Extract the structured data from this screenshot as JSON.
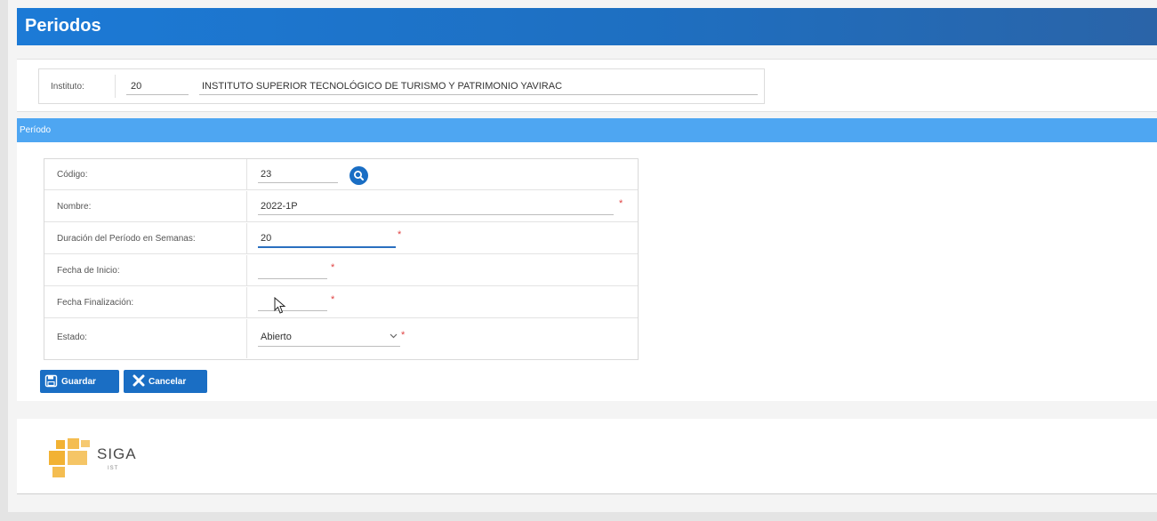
{
  "header": {
    "title": "Periodos"
  },
  "instituto": {
    "label": "Instituto:",
    "code": "20",
    "name": "INSTITUTO SUPERIOR TECNOLÓGICO DE TURISMO Y PATRIMONIO YAVIRAC"
  },
  "periodo": {
    "section_title": "Período",
    "fields": {
      "codigo": {
        "label": "Código:",
        "value": "23"
      },
      "nombre": {
        "label": "Nombre:",
        "value": "2022-1P"
      },
      "duracion": {
        "label": "Duración del Período en Semanas:",
        "value": "20"
      },
      "fecha_inicio": {
        "label": "Fecha de Inicio:",
        "value": ""
      },
      "fecha_fin": {
        "label": "Fecha Finalización:",
        "value": ""
      },
      "estado": {
        "label": "Estado:",
        "value": "Abierto"
      }
    },
    "required_mark": "*"
  },
  "actions": {
    "save_label": "Guardar",
    "cancel_label": "Cancelar"
  },
  "footer": {
    "logo_text": "SIGA",
    "logo_sub": "IST"
  },
  "colors": {
    "primary": "#1a6ec4",
    "section_bar": "#4ea6f2",
    "required": "#e04343",
    "logo": "#f2b233"
  },
  "icons": {
    "search": "search-icon",
    "save": "floppy-disk-icon",
    "cancel": "close-icon",
    "dropdown": "chevron-down-icon",
    "cursor": "mouse-pointer-icon"
  }
}
